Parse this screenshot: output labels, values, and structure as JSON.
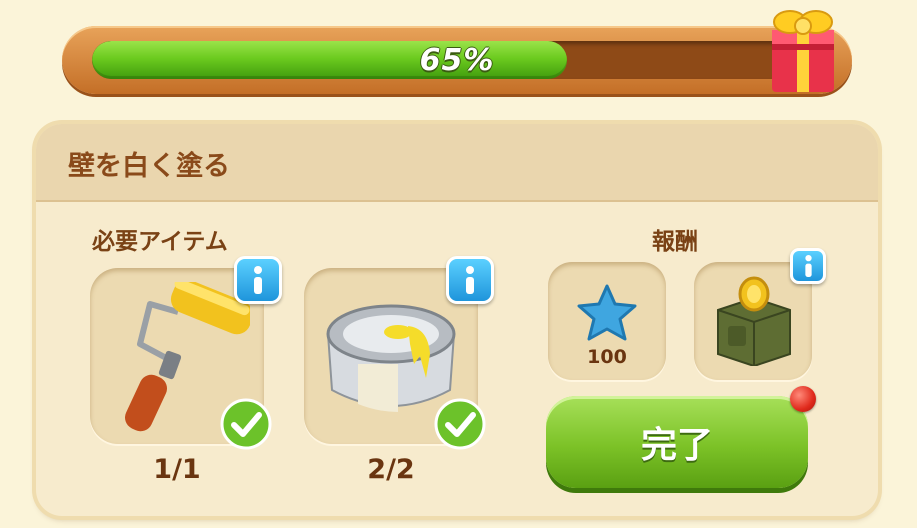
{
  "progress": {
    "value": 0.65,
    "label": "65%"
  },
  "task": {
    "title": "壁を白く塗る"
  },
  "required": {
    "label": "必要アイテム",
    "items": [
      {
        "name": "paint-roller",
        "count": "1/1",
        "complete": true
      },
      {
        "name": "white-paint-can",
        "count": "2/2",
        "complete": true
      }
    ]
  },
  "reward": {
    "label": "報酬",
    "items": [
      {
        "name": "star",
        "count": "100"
      },
      {
        "name": "coin-chest"
      }
    ]
  },
  "complete_button": {
    "label": "完了"
  },
  "colors": {
    "accent_green": "#7cc227",
    "title_brown": "#8a4a1a",
    "info_blue": "#1f95db"
  }
}
